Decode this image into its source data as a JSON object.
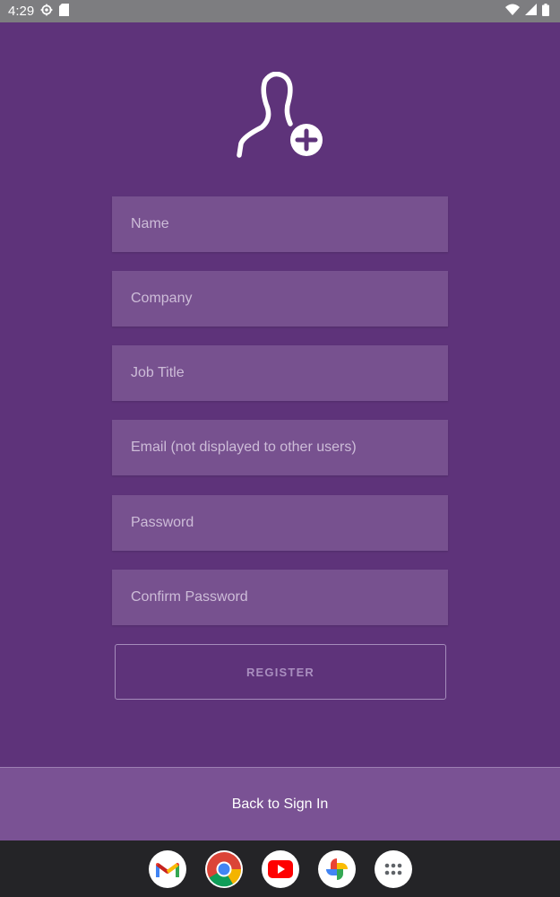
{
  "status_bar": {
    "time": "4:29",
    "left_icons": [
      "settings-gear-icon",
      "sd-card-icon"
    ],
    "right_icons": [
      "wifi-icon",
      "cell-signal-icon",
      "battery-icon"
    ]
  },
  "logo": {
    "icon": "add-user-icon"
  },
  "form": {
    "name_placeholder": "Name",
    "company_placeholder": "Company",
    "job_title_placeholder": "Job Title",
    "email_placeholder": "Email (not displayed to other users)",
    "password_placeholder": "Password",
    "confirm_password_placeholder": "Confirm Password",
    "register_label": "REGISTER"
  },
  "footer": {
    "back_label": "Back to Sign In"
  },
  "dock": {
    "apps": [
      "gmail-icon",
      "chrome-icon",
      "youtube-icon",
      "photos-icon",
      "app-drawer-icon"
    ]
  },
  "colors": {
    "background": "#5e337a",
    "field": "#77518f",
    "footer": "#7a5294",
    "status_bar": "#7d7d80",
    "nav_bar": "#242427"
  }
}
